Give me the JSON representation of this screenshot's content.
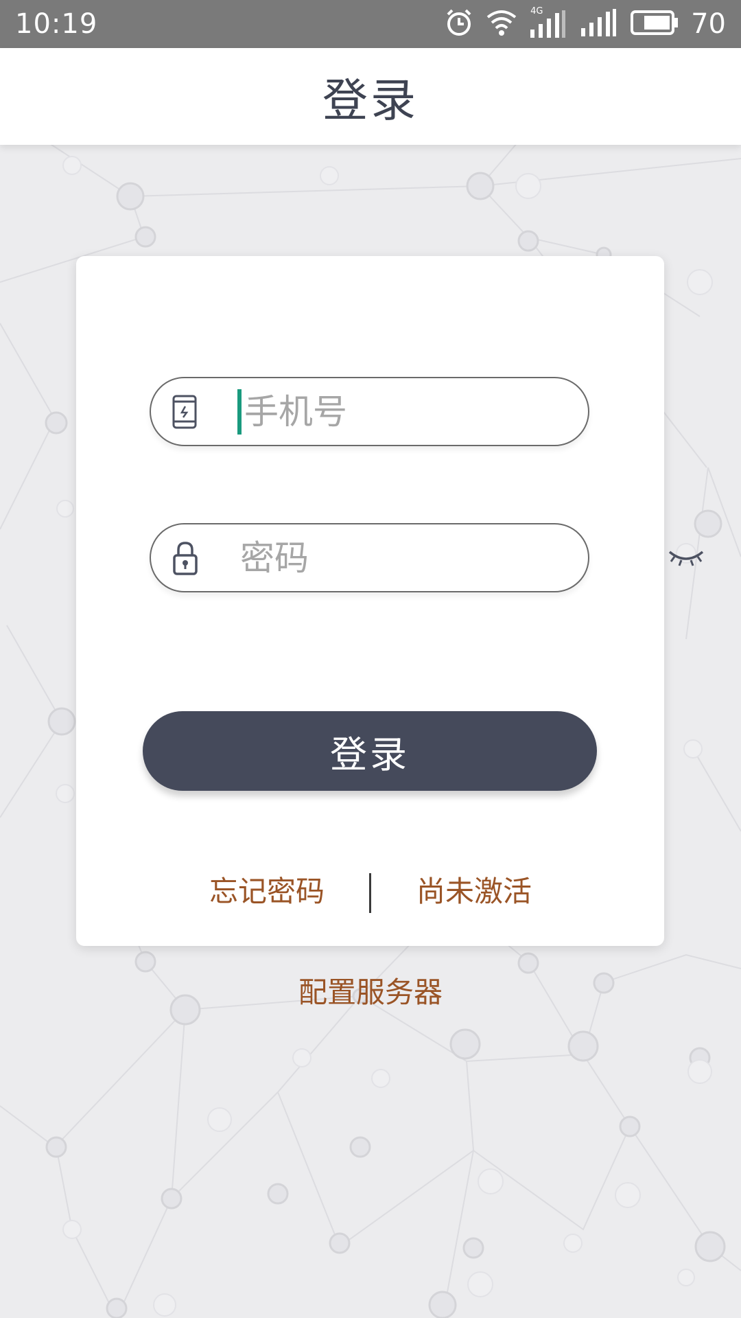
{
  "status_bar": {
    "time": "10:19",
    "network_label": "4G",
    "battery": "70"
  },
  "header": {
    "title": "登录"
  },
  "form": {
    "phone_placeholder": "手机号",
    "password_placeholder": "密码",
    "phone_icon": "phone-icon",
    "lock_icon": "lock-icon",
    "eye_icon": "eye-closed-icon"
  },
  "actions": {
    "login_label": "登录",
    "forgot_password": "忘记密码",
    "not_activated": "尚未激活",
    "configure_server": "配置服务器"
  },
  "colors": {
    "status_bar": "#7a7a7a",
    "title_text": "#3e4352",
    "button": "#454a5b",
    "link": "#9a5426",
    "cursor": "#1a9a7e"
  }
}
